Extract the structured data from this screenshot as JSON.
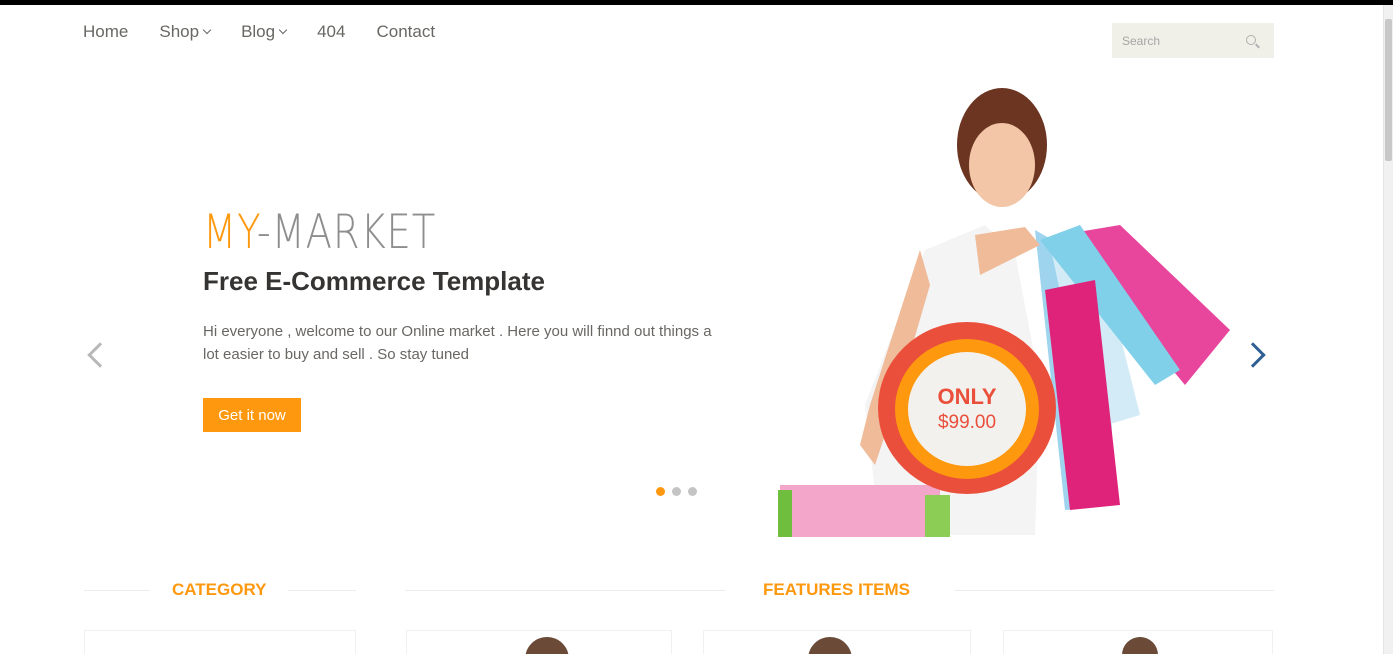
{
  "nav": {
    "items": [
      {
        "label": "Home",
        "dropdown": false
      },
      {
        "label": "Shop",
        "dropdown": true
      },
      {
        "label": "Blog",
        "dropdown": true
      },
      {
        "label": "404",
        "dropdown": false
      },
      {
        "label": "Contact",
        "dropdown": false
      }
    ]
  },
  "search": {
    "placeholder": "Search",
    "icon": "search-icon"
  },
  "slider": {
    "brand_part1": "MY",
    "brand_part2": "-MARKET",
    "headline": "Free E-Commerce Template",
    "description": "Hi everyone , welcome to our Online market . Here you will finnd out things a lot easier to buy and sell . So stay tuned",
    "cta_label": "Get it now",
    "active_dot": 0,
    "dot_count": 3
  },
  "badge": {
    "title": "ONLY",
    "price": "$99.00"
  },
  "sections": {
    "category_title": "CATEGORY",
    "features_title": "FEATURES ITEMS"
  },
  "colors": {
    "accent": "#fe980f",
    "badge_red": "#ea4f3c",
    "nav_text": "#696763",
    "arrow_right": "#2f5f93"
  }
}
